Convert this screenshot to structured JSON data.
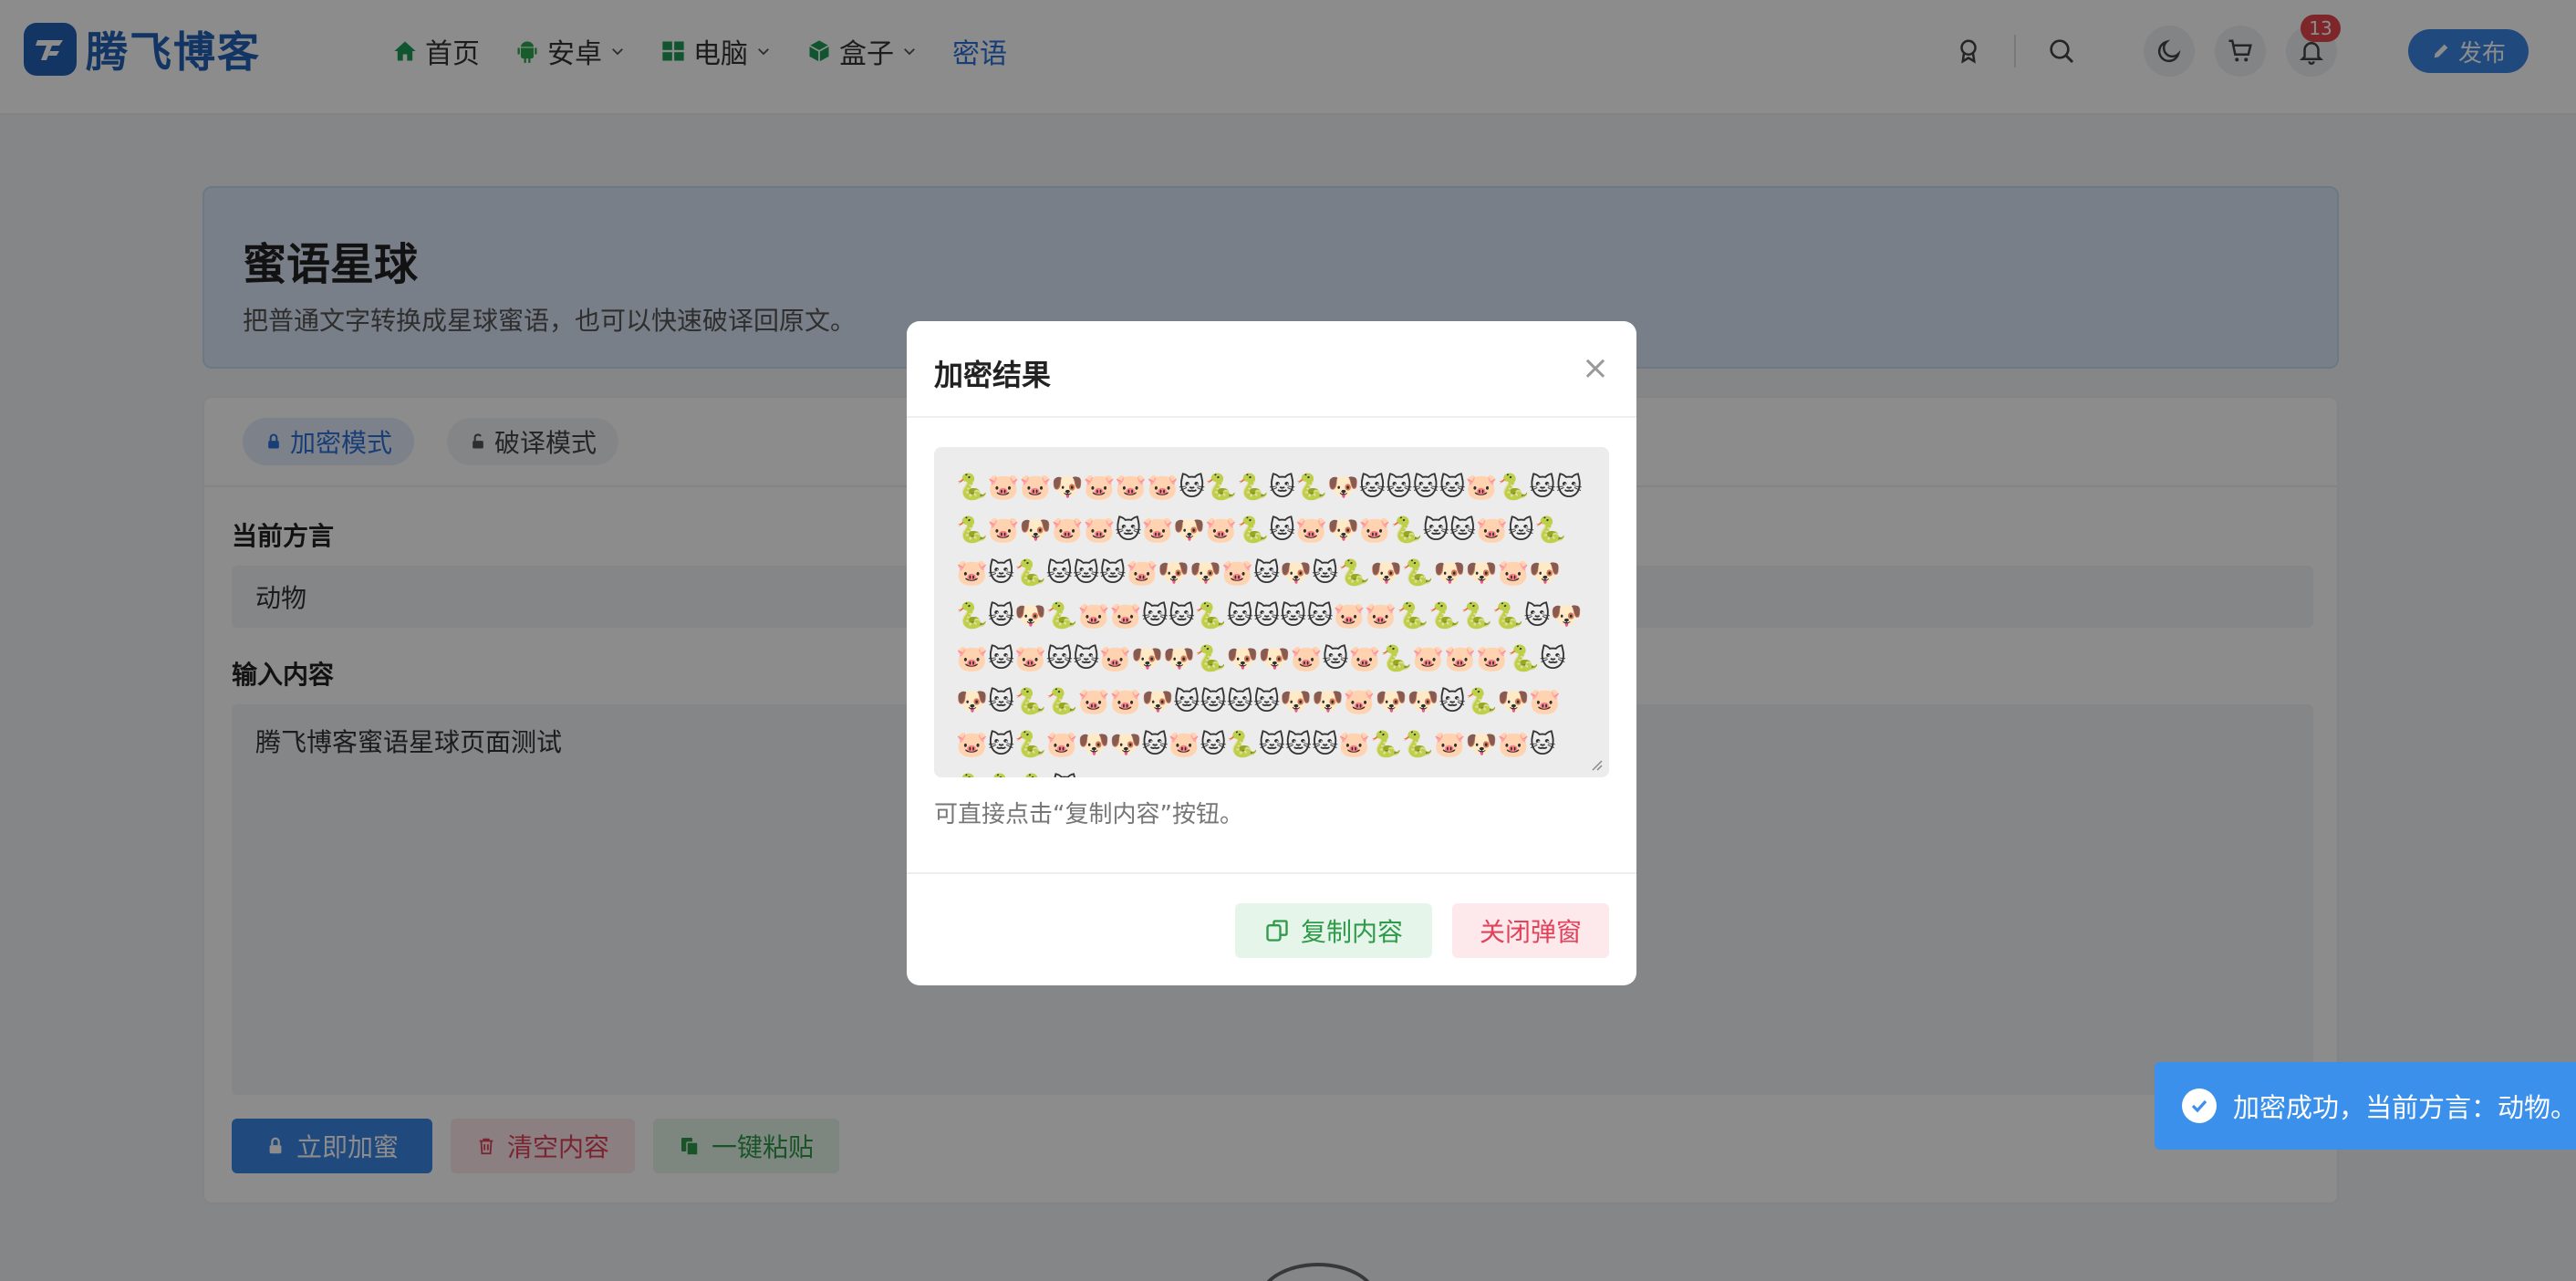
{
  "header": {
    "logo_text": "腾飞博客",
    "nav": [
      {
        "label": "首页",
        "icon": "home-icon",
        "has_dropdown": false
      },
      {
        "label": "安卓",
        "icon": "android-icon",
        "has_dropdown": true
      },
      {
        "label": "电脑",
        "icon": "windows-icon",
        "has_dropdown": true
      },
      {
        "label": "盒子",
        "icon": "box-icon",
        "has_dropdown": true
      },
      {
        "label": "密语",
        "icon": "",
        "has_dropdown": false
      }
    ],
    "active_nav": "密语",
    "notification_count": "13",
    "publish_label": "发布"
  },
  "hero": {
    "title": "蜜语星球",
    "subtitle": "把普通文字转换成星球蜜语，也可以快速破译回原文。"
  },
  "card": {
    "tabs": [
      {
        "label": "加密模式",
        "active": true
      },
      {
        "label": "破译模式",
        "active": false
      }
    ],
    "dialect_label": "当前方言",
    "dialect_value": "动物",
    "input_label": "输入内容",
    "input_value": "腾飞博客蜜语星球页面测试",
    "buttons": {
      "encrypt": "立即加蜜",
      "clear": "清空内容",
      "paste": "一键粘贴"
    }
  },
  "modal": {
    "title": "加密结果",
    "close_glyph": "×",
    "result_text": "🐍🐷🐷🐶🐷🐷🐷🐱🐍🐍🐱🐍🐶🐱🐱🐱🐱🐷🐍🐱🐱🐍🐷🐶🐷🐷🐱🐷🐶🐷🐍🐱🐷🐶🐷🐍🐱🐱🐷🐱🐍🐷🐱🐍🐱🐱🐱🐷🐶🐶🐷🐱🐶🐱🐍🐶🐍🐶🐶🐷🐶🐍🐱🐶🐍🐷🐷🐱🐱🐍🐱🐱🐱🐱🐷🐷🐍🐍🐍🐍🐱🐶🐷🐱🐷🐱🐱🐷🐶🐶🐍🐶🐶🐷🐱🐷🐍🐷🐷🐷🐍🐱🐶🐱🐍🐍🐷🐷🐶🐱🐱🐱🐱🐶🐶🐷🐶🐶🐱🐍🐶🐷🐷🐱🐍🐷🐶🐶🐱🐷🐱🐍🐱🐱🐱🐷🐍🐍🐷🐶🐷🐱🐍🐍🐍🐱",
    "hint": "可直接点击“复制内容”按钮。",
    "copy_label": "复制内容",
    "close_label": "关闭弹窗"
  },
  "toast": {
    "message": "加密成功，当前方言：动物。"
  },
  "colors": {
    "brand": "#2262b4",
    "accent": "#3b86e6",
    "success": "#2f9a4a",
    "danger": "#e0435a",
    "badge": "#e5484d"
  }
}
